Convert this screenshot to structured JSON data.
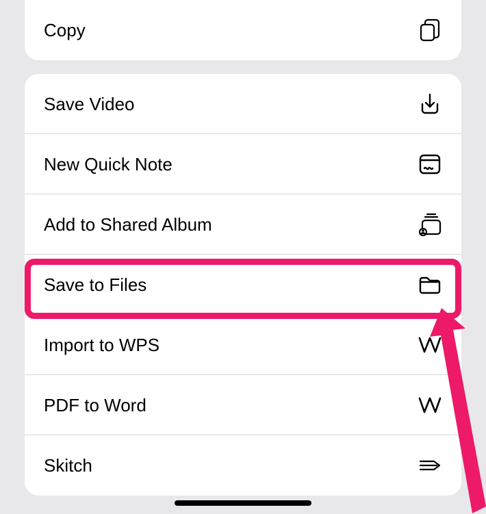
{
  "groups": [
    {
      "items": [
        {
          "key": "copy",
          "label": "Copy",
          "icon": "copy-icon"
        }
      ]
    },
    {
      "items": [
        {
          "key": "save_video",
          "label": "Save Video",
          "icon": "download-icon"
        },
        {
          "key": "new_quick_note",
          "label": "New Quick Note",
          "icon": "quicknote-icon"
        },
        {
          "key": "add_to_shared_album",
          "label": "Add to Shared Album",
          "icon": "shared-album-icon"
        },
        {
          "key": "save_to_files",
          "label": "Save to Files",
          "icon": "folder-icon",
          "highlighted": true
        },
        {
          "key": "import_to_wps",
          "label": "Import to WPS",
          "icon": "wps-icon"
        },
        {
          "key": "pdf_to_word",
          "label": "PDF to Word",
          "icon": "wps-icon"
        },
        {
          "key": "skitch",
          "label": "Skitch",
          "icon": "skitch-icon"
        }
      ]
    }
  ],
  "annotation": {
    "highlight_color": "#ec1a68"
  }
}
